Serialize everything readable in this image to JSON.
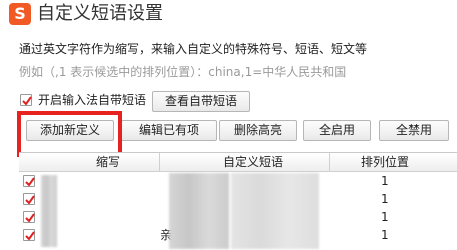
{
  "window": {
    "title": "自定义短语设置",
    "icon": "sogou-s-logo",
    "icon_glyph": "S"
  },
  "description": "通过英文字符作为缩写，来输入自定义的特殊符号、短语、短文等",
  "example": "例如（,1 表示候选中的排列位置）：china,1=中华人民共和国",
  "enable_checkbox": {
    "label": "开启输入法自带短语",
    "checked": true
  },
  "buttons": {
    "view_builtin": "查看自带短语",
    "add_new": "添加新定义",
    "edit_existing": "编辑已有项",
    "delete_highlight": "删除高亮",
    "enable_all": "全启用",
    "disable_all": "全禁用"
  },
  "table": {
    "columns": [
      "缩写",
      "自定义短语",
      "排列位置"
    ],
    "rows": [
      {
        "checked": true,
        "abbr": "",
        "phrase": "",
        "position": "1"
      },
      {
        "checked": true,
        "abbr": "",
        "phrase": "",
        "position": "1"
      },
      {
        "checked": true,
        "abbr": "",
        "phrase": "",
        "position": "1"
      },
      {
        "checked": true,
        "abbr": "",
        "phrase": "亲",
        "position": "1"
      }
    ]
  },
  "colors": {
    "highlight_border": "#e6231e",
    "brand": "#f15a24",
    "checkmark": "#e02020"
  }
}
